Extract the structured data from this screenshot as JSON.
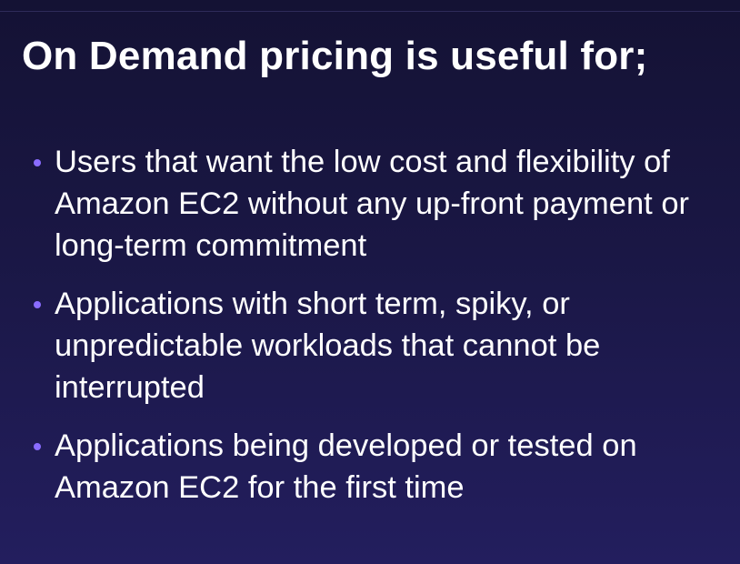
{
  "slide": {
    "title": "On Demand pricing is useful for;",
    "accent_color": "#8a6cff",
    "bullets": [
      {
        "lines": [
          "Users that want the low cost and flexibility of",
          "Amazon EC2 without any up-front payment or",
          "long-term commitment"
        ]
      },
      {
        "lines": [
          "Applications with short term, spiky, or",
          "unpredictable workloads that cannot be",
          "interrupted"
        ]
      },
      {
        "lines": [
          "Applications being developed or tested on",
          "Amazon EC2 for the first time"
        ]
      }
    ]
  }
}
